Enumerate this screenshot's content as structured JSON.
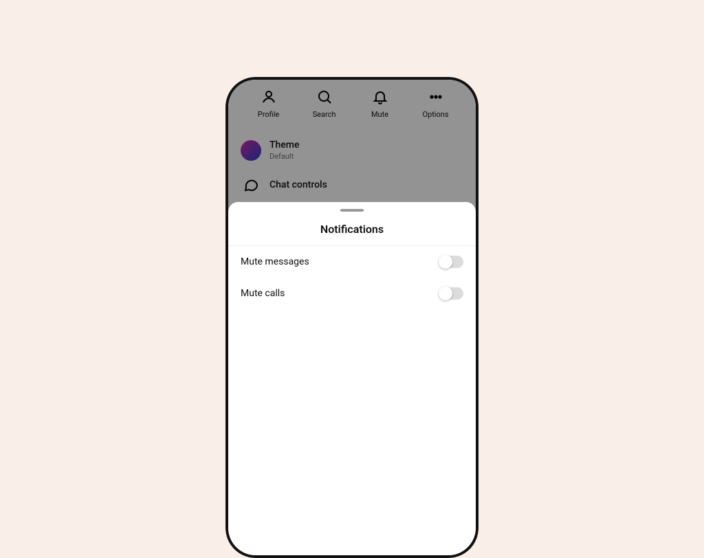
{
  "topActions": {
    "profile": "Profile",
    "search": "Search",
    "mute": "Mute",
    "options": "Options"
  },
  "list": {
    "theme": {
      "title": "Theme",
      "subtitle": "Default"
    },
    "chatControls": {
      "title": "Chat controls"
    }
  },
  "sheet": {
    "title": "Notifications",
    "rows": {
      "muteMessages": "Mute messages",
      "muteCalls": "Mute calls"
    }
  }
}
